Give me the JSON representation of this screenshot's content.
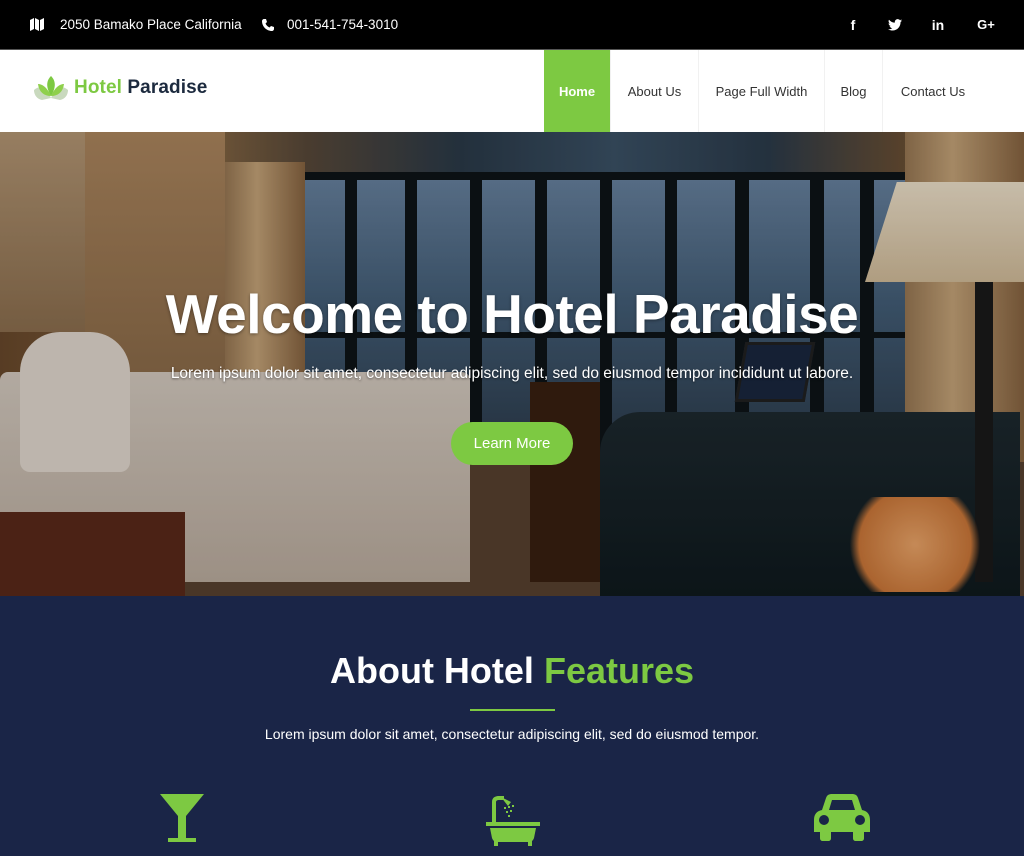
{
  "topbar": {
    "address": "2050 Bamako Place California",
    "address_icon": "map-icon",
    "phone": "001-541-754-3010",
    "phone_icon": "phone-icon",
    "social": [
      {
        "name": "facebook-icon",
        "glyph": "f"
      },
      {
        "name": "twitter-icon",
        "glyph": "t"
      },
      {
        "name": "linkedin-icon",
        "glyph": "in"
      },
      {
        "name": "google-plus-icon",
        "glyph": "G+"
      }
    ]
  },
  "header": {
    "logo_icon": "lotus-icon",
    "logo_part1": "Hotel",
    "logo_part2": "Paradise",
    "nav": [
      {
        "label": "Home",
        "active": true
      },
      {
        "label": "About Us",
        "active": false
      },
      {
        "label": "Page Full Width",
        "active": false
      },
      {
        "label": "Blog",
        "active": false
      },
      {
        "label": "Contact Us",
        "active": false
      }
    ]
  },
  "hero": {
    "title": "Welcome to Hotel Paradise",
    "subtitle": "Lorem ipsum dolor sit amet, consectetur adipiscing elit, sed do eiusmod tempor incididunt ut labore.",
    "button_label": "Learn More"
  },
  "about": {
    "title_part1": "About Hotel",
    "title_part2": "Features",
    "subtitle": "Lorem ipsum dolor sit amet, consectetur adipiscing elit, sed do eiusmod tempor.",
    "features": [
      {
        "icon": "cocktail-icon"
      },
      {
        "icon": "bathtub-icon"
      },
      {
        "icon": "car-icon"
      }
    ]
  },
  "colors": {
    "accent": "#7dc942",
    "navy": "#1a2547",
    "topbar": "#000000"
  }
}
